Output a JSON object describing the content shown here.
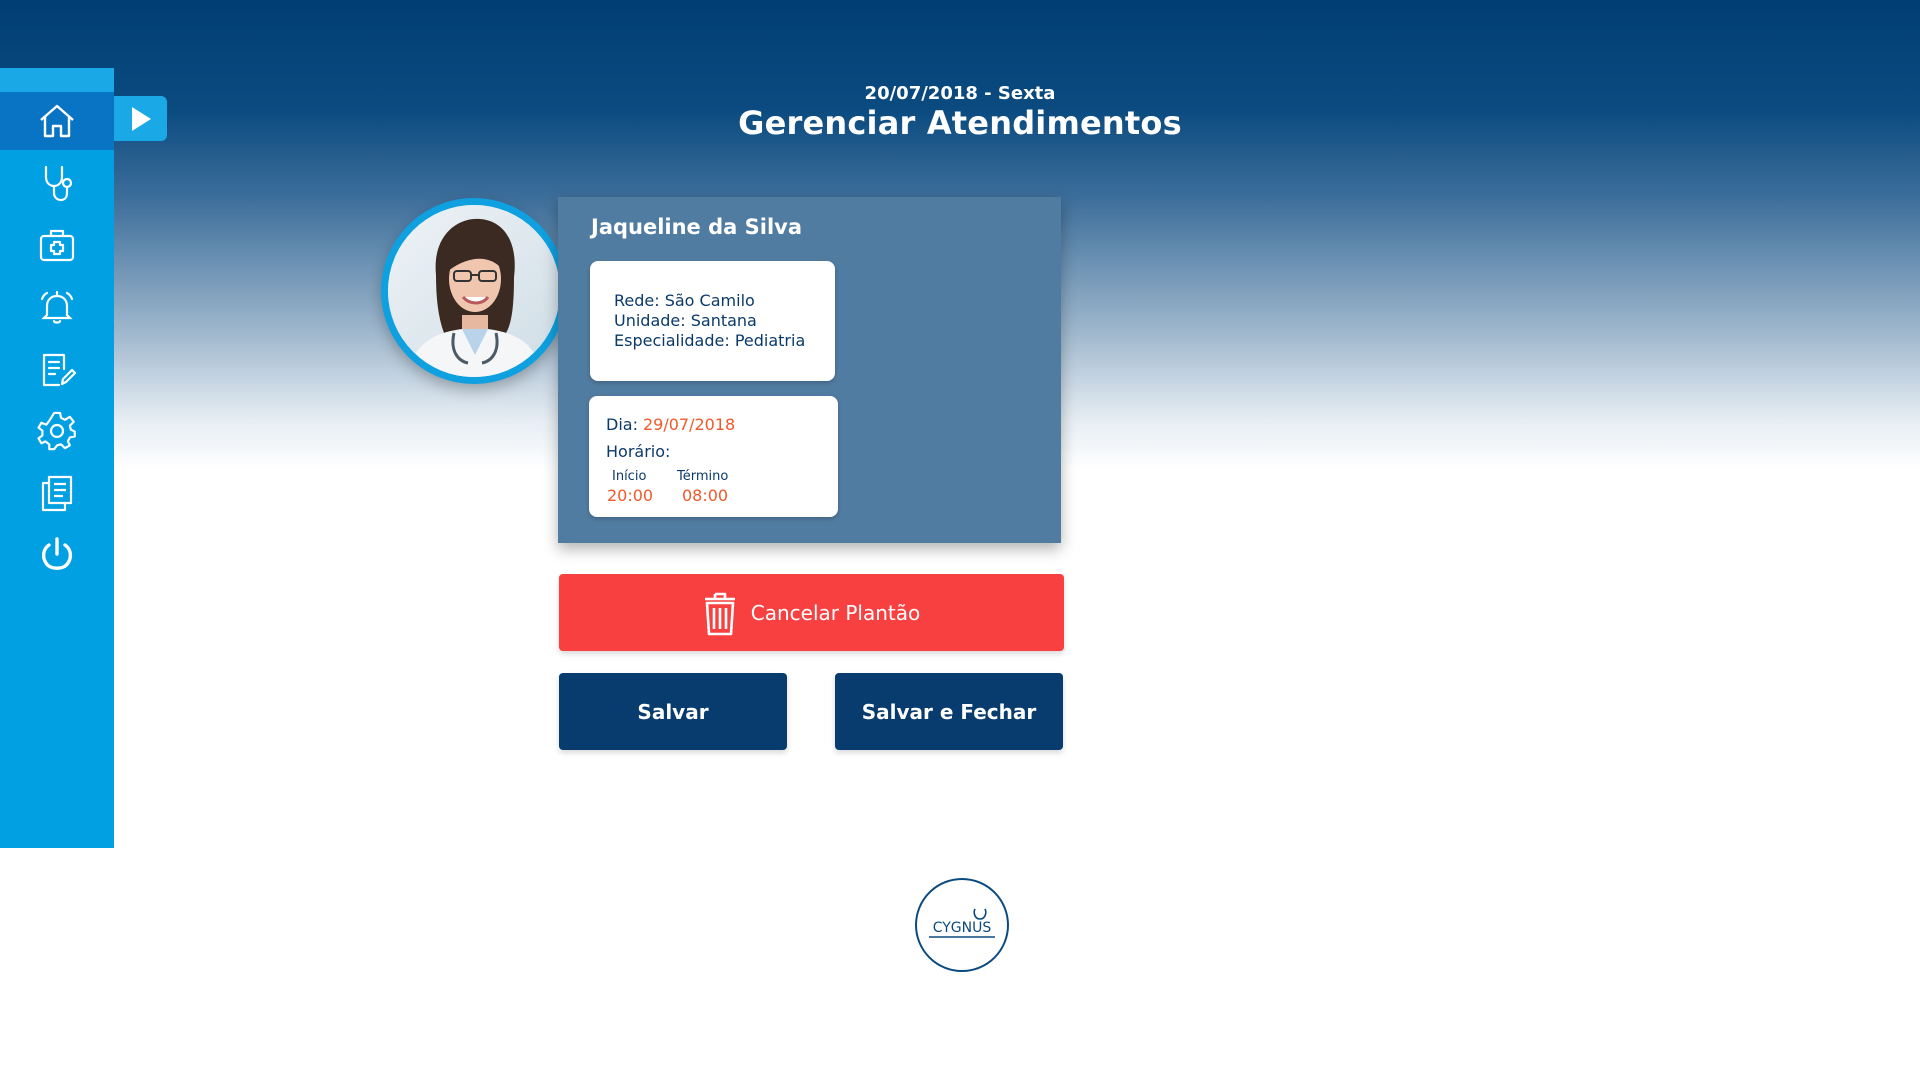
{
  "header": {
    "date": "20/07/2018 - Sexta",
    "title": "Gerenciar Atendimentos"
  },
  "sidebar": {
    "items": [
      {
        "name": "home",
        "icon": "home-icon",
        "active": true
      },
      {
        "name": "stethoscope",
        "icon": "stethoscope-icon"
      },
      {
        "name": "medical-kit",
        "icon": "medical-kit-icon"
      },
      {
        "name": "alarm",
        "icon": "alarm-bell-icon"
      },
      {
        "name": "notes",
        "icon": "edit-document-icon"
      },
      {
        "name": "settings",
        "icon": "gear-icon"
      },
      {
        "name": "documents",
        "icon": "documents-icon"
      },
      {
        "name": "logout",
        "icon": "power-icon"
      }
    ],
    "expand_icon": "play-arrow-icon"
  },
  "card": {
    "name": "Jaqueline da Silva",
    "rede": "Rede: São Camilo",
    "unidade": "Unidade: Santana",
    "especialidade": "Especialidade: Pediatria",
    "dia_label": "Dia:",
    "dia_value": "29/07/2018",
    "horario_label": "Horário:",
    "inicio_label": "Início",
    "inicio_value": "20:00",
    "termino_label": "Término",
    "termino_value": "08:00"
  },
  "actions": {
    "cancel_label": "Cancelar Plantão",
    "save_label": "Salvar",
    "save_close_label": "Salvar e Fechar"
  },
  "logo": {
    "text": "CYGNUS"
  },
  "colors": {
    "sidebar": "#00a0e3",
    "sidebar_active": "#0a74c4",
    "card": "#517ca1",
    "danger": "#f94040",
    "primary_dark": "#083c6e",
    "accent_orange": "#f0592a"
  }
}
